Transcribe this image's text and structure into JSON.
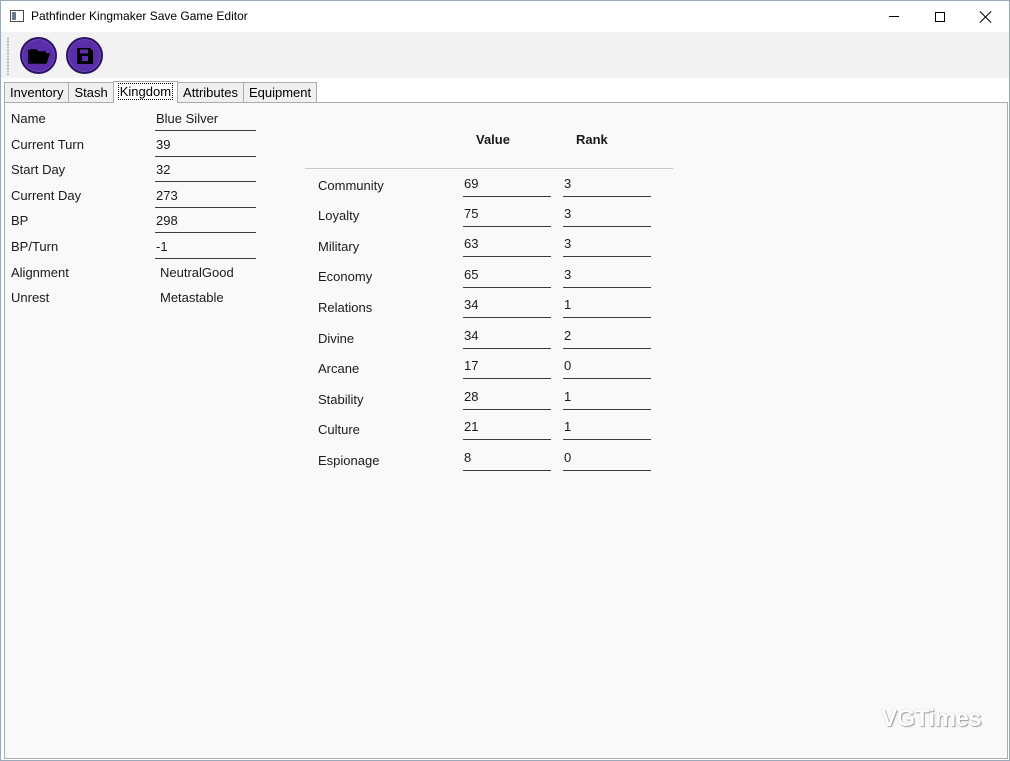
{
  "window": {
    "title": "Pathfinder Kingmaker Save Game Editor",
    "controls": {
      "minimize": "minimize",
      "maximize": "maximize",
      "close": "close"
    }
  },
  "toolbar": {
    "buttons": [
      {
        "name": "open",
        "icon": "folder-open-icon"
      },
      {
        "name": "save",
        "icon": "floppy-disk-icon"
      }
    ],
    "button_color": "#5a2ea8"
  },
  "tabs": [
    {
      "label": "Inventory",
      "active": false
    },
    {
      "label": "Stash",
      "active": false
    },
    {
      "label": "Kingdom",
      "active": true
    },
    {
      "label": "Attributes",
      "active": false
    },
    {
      "label": "Equipment",
      "active": false
    }
  ],
  "kingdom": {
    "name": {
      "label": "Name",
      "value": "Blue Silver"
    },
    "current_turn": {
      "label": "Current Turn",
      "value": "39"
    },
    "start_day": {
      "label": "Start Day",
      "value": "32"
    },
    "current_day": {
      "label": "Current Day",
      "value": "273"
    },
    "bp": {
      "label": "BP",
      "value": "298"
    },
    "bp_per_turn": {
      "label": "BP/Turn",
      "value": "-1"
    },
    "alignment": {
      "label": "Alignment",
      "value": "NeutralGood"
    },
    "unrest": {
      "label": "Unrest",
      "value": "Metastable"
    }
  },
  "stats_table": {
    "value_header": "Value",
    "rank_header": "Rank",
    "rows": [
      {
        "label": "Community",
        "value": "69",
        "rank": "3"
      },
      {
        "label": "Loyalty",
        "value": "75",
        "rank": "3"
      },
      {
        "label": "Military",
        "value": "63",
        "rank": "3"
      },
      {
        "label": "Economy",
        "value": "65",
        "rank": "3"
      },
      {
        "label": "Relations",
        "value": "34",
        "rank": "1"
      },
      {
        "label": "Divine",
        "value": "34",
        "rank": "2"
      },
      {
        "label": "Arcane",
        "value": "17",
        "rank": "0"
      },
      {
        "label": "Stability",
        "value": "28",
        "rank": "1"
      },
      {
        "label": "Culture",
        "value": "21",
        "rank": "1"
      },
      {
        "label": "Espionage",
        "value": "8",
        "rank": "0"
      }
    ]
  },
  "watermark": "VGTimes"
}
